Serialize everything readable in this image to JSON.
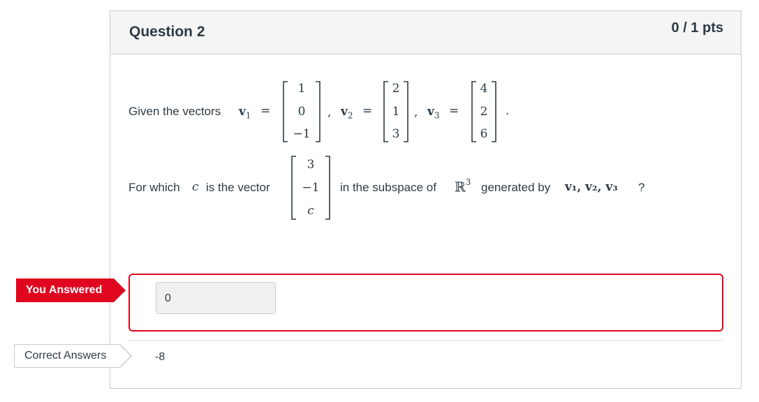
{
  "question": {
    "title": "Question 2",
    "points": "0 / 1 pts"
  },
  "prompt": {
    "line1_text": "Given the vectors",
    "v1_label": "v",
    "v1_sub": "1",
    "v2_label": "v",
    "v2_sub": "2",
    "v3_label": "v",
    "v3_sub": "3",
    "equals": "=",
    "comma": ",",
    "period": ".",
    "v1": [
      "1",
      "0",
      "−1"
    ],
    "v2": [
      "2",
      "1",
      "3"
    ],
    "v3": [
      "4",
      "2",
      "6"
    ],
    "line2_pre": "For which",
    "c_var": "c",
    "line2_mid": "is the vector",
    "target_vec": [
      "3",
      "−1",
      "c"
    ],
    "line2_post": "in the subspace of",
    "field": "ℝ",
    "field_exp": "3",
    "line2_gen": "generated by",
    "gen_vectors": "v₁, v₂, v₃",
    "qmark": "?"
  },
  "you_answered": {
    "tag": "You Answered",
    "value": "0"
  },
  "correct_answers": {
    "tag": "Correct Answers",
    "value": "-8"
  }
}
